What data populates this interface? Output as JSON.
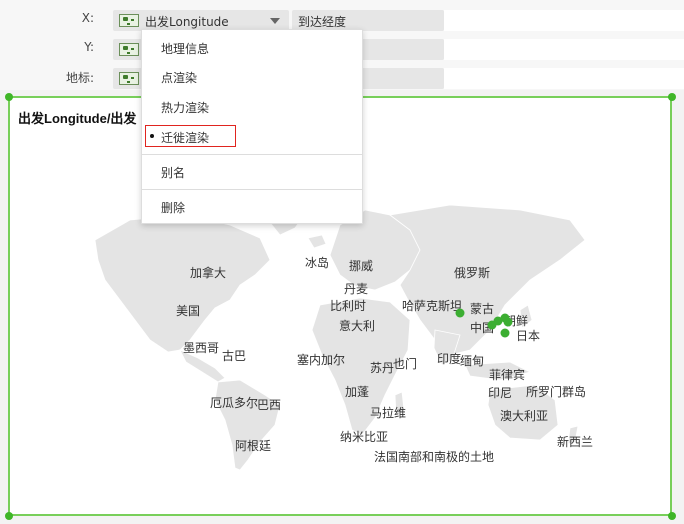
{
  "fields": {
    "x": {
      "label": "X:",
      "value": "出发Longitude",
      "secondary": "到达经度"
    },
    "y": {
      "label": "Y:"
    },
    "geo": {
      "label": "地标:"
    }
  },
  "chart": {
    "title": "出发Longitude/出发",
    "countries": [
      "冰岛",
      "挪威",
      "丹麦",
      "比利时",
      "意大利",
      "俄罗斯",
      "哈萨克斯坦",
      "蒙古",
      "中国",
      "朝鲜",
      "日本",
      "加拿大",
      "美国",
      "墨西哥",
      "古巴",
      "塞内加尔",
      "苏丹",
      "也门",
      "印度",
      "缅甸",
      "菲律宾",
      "印尼",
      "所罗门群岛",
      "加蓬",
      "马拉维",
      "澳大利亚",
      "厄瓜多尔",
      "巴西",
      "阿根廷",
      "纳米比亚",
      "新西兰",
      "法国南部和南极的土地"
    ],
    "point_color": "#3cae32"
  },
  "menu": {
    "items": [
      "地理信息",
      "点渲染",
      "热力渲染",
      "迁徙渲染",
      "别名",
      "删除"
    ],
    "selected": "迁徙渲染"
  }
}
